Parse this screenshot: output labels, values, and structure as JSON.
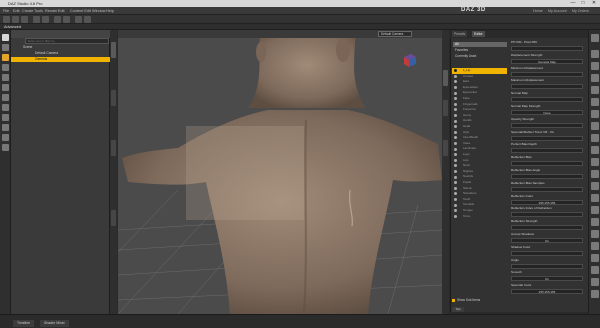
{
  "window": {
    "title": "DAZ Studio 4.6 Pro",
    "controls": [
      "—",
      "□",
      "✕"
    ]
  },
  "menu": {
    "items": [
      "File",
      "Edit",
      "Create",
      "Tools",
      "Render",
      "Edit",
      "Content Edit",
      "Window",
      "Help"
    ],
    "logo": "DAZ 3D",
    "links": [
      "Home",
      "My Account",
      "My Orders"
    ]
  },
  "layout": {
    "tab_label": "Advanced"
  },
  "scene": {
    "search_placeholder": "Enter text to filter by...",
    "items": [
      {
        "label": "Scene",
        "selected": false,
        "indent": 0
      },
      {
        "label": "Default Camera",
        "selected": false,
        "indent": 1
      },
      {
        "label": "Genesis",
        "selected": true,
        "indent": 1
      }
    ]
  },
  "viewport": {
    "camera": "Default Camera"
  },
  "surfaces": {
    "tabs": [
      {
        "label": "Presets",
        "active": false
      },
      {
        "label": "Editor",
        "active": true
      },
      {
        "label": "Shader - Iray Uber",
        "active": false
      }
    ],
    "categories": [
      {
        "label": "All",
        "active": false
      },
      {
        "label": "Favorites",
        "active": false
      },
      {
        "label": "Currently Used",
        "active": false
      }
    ],
    "surface_items": [
      {
        "label": "1_Lip",
        "selected": true
      },
      {
        "label": "Cornea",
        "selected": false
      },
      {
        "label": "Ears",
        "selected": false
      },
      {
        "label": "EyeLashes",
        "selected": false
      },
      {
        "label": "Eyesocket",
        "selected": false
      },
      {
        "label": "Face",
        "selected": false
      },
      {
        "label": "Fingernails",
        "selected": false
      },
      {
        "label": "Forearms",
        "selected": false
      },
      {
        "label": "Gums",
        "selected": false
      },
      {
        "label": "Hands",
        "selected": false
      },
      {
        "label": "Head",
        "selected": false
      },
      {
        "label": "Hips",
        "selected": false
      },
      {
        "label": "InnerMouth",
        "selected": false
      },
      {
        "label": "Irises",
        "selected": false
      },
      {
        "label": "Lacrimals",
        "selected": false
      },
      {
        "label": "Legs",
        "selected": false
      },
      {
        "label": "Lips",
        "selected": false
      },
      {
        "label": "Neck",
        "selected": false
      },
      {
        "label": "Nipples",
        "selected": false
      },
      {
        "label": "Nostrils",
        "selected": false
      },
      {
        "label": "Pupils",
        "selected": false
      },
      {
        "label": "Sclera",
        "selected": false
      },
      {
        "label": "Shoulders",
        "selected": false
      },
      {
        "label": "Teeth",
        "selected": false
      },
      {
        "label": "Toenails",
        "selected": false
      },
      {
        "label": "Tongue",
        "selected": false
      },
      {
        "label": "Torso",
        "selected": false
      }
    ],
    "properties": [
      {
        "label": "PH 030 - Pixel 050",
        "value": ""
      },
      {
        "label": "Displacement Strength",
        "value": "Genesis Map"
      },
      {
        "label": "Minimum Displacement",
        "value": ""
      },
      {
        "label": "Maximum Displacement",
        "value": ""
      },
      {
        "label": "Normal Map",
        "value": ""
      },
      {
        "label": "Normal Map Strength",
        "value": "None"
      },
      {
        "label": "Opacity Strength",
        "value": ""
      },
      {
        "label": "Specular/Reflect Tranz Off - On",
        "value": ""
      },
      {
        "label": "Perfect Bias Depth",
        "value": ""
      },
      {
        "label": "Reflection Bias",
        "value": ""
      },
      {
        "label": "Reflection Bias Angle",
        "value": ""
      },
      {
        "label": "Reflection Bias Samples",
        "value": ""
      },
      {
        "label": "Reflection Color",
        "value": "255   255   255"
      },
      {
        "label": "Reflection Index of Refraction",
        "value": ""
      },
      {
        "label": "Reflection Strength",
        "value": ""
      },
      {
        "label": "Accept Shadows",
        "value": "On"
      },
      {
        "label": "Shadow Color",
        "value": ""
      },
      {
        "label": "Angle",
        "value": ""
      },
      {
        "label": "Smooth",
        "value": "On"
      },
      {
        "label": "Specular Color",
        "value": "255   255   255"
      }
    ],
    "show_sub_items": "Show Sub Items",
    "tips": "Tips"
  },
  "left_vertical_tabs": [
    "Scene",
    "Content Library",
    "Smart Content",
    "Parameters"
  ],
  "right_vertical_tabs": [
    "Surfaces",
    "Lights",
    "Shaping"
  ],
  "bottom": {
    "tabs": [
      "Timeline",
      "Shader Mixer"
    ]
  },
  "colors": {
    "selection": "#f0b400",
    "panel": "#323232",
    "viewport_bg": "#4b4b4b",
    "skin": "#8a7565"
  }
}
